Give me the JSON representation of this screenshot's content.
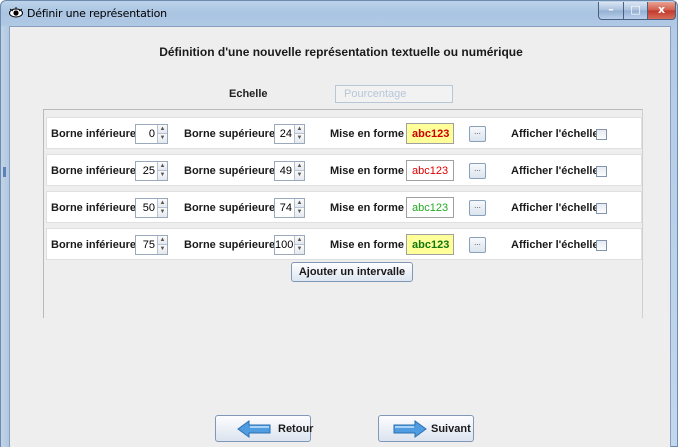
{
  "window": {
    "title": "Définir une représentation",
    "controls": {
      "minimize": "–",
      "maximize": "□",
      "close": "x"
    }
  },
  "main": {
    "title": "Définition d'une nouvelle représentation textuelle ou numérique",
    "echelle_label": "Echelle",
    "echelle_value": "Pourcentage"
  },
  "intervals": [
    {
      "lower_label": "Borne inférieure:",
      "lower": "0",
      "upper_label": "Borne supérieure:",
      "upper": "24",
      "format_label": "Mise en forme :",
      "format_text": "abc123",
      "format_text_color": "#cc0000",
      "format_bg": "#ffff99",
      "format_bold": true,
      "format_btn": "...",
      "show_scale_label": "Afficher l'échelle:",
      "show_scale": false
    },
    {
      "lower_label": "Borne inférieure:",
      "lower": "25",
      "upper_label": "Borne supérieure:",
      "upper": "49",
      "format_label": "Mise en forme :",
      "format_text": "abc123",
      "format_text_color": "#dd0000",
      "format_bg": "#ffffff",
      "format_bold": false,
      "format_btn": "...",
      "show_scale_label": "Afficher l'échelle:",
      "show_scale": false
    },
    {
      "lower_label": "Borne inférieure:",
      "lower": "50",
      "upper_label": "Borne supérieure:",
      "upper": "74",
      "format_label": "Mise en forme :",
      "format_text": "abc123",
      "format_text_color": "#22aa22",
      "format_bg": "#ffffff",
      "format_bold": false,
      "format_btn": "...",
      "show_scale_label": "Afficher l'échelle:",
      "show_scale": false
    },
    {
      "lower_label": "Borne inférieure:",
      "lower": "75",
      "upper_label": "Borne supérieure:",
      "upper": "100",
      "format_label": "Mise en forme :",
      "format_text": "abc123",
      "format_text_color": "#117711",
      "format_bg": "#ffff99",
      "format_bold": true,
      "format_btn": "...",
      "show_scale_label": "Afficher l'échelle:",
      "show_scale": false
    }
  ],
  "actions": {
    "add_interval": "Ajouter un intervalle",
    "back": "Retour",
    "next": "Suivant"
  },
  "icons": {
    "title": "eye-icon",
    "back": "arrow-left-icon",
    "next": "arrow-right-icon"
  },
  "colors": {
    "arrow_fill": "#4f9de0",
    "arrow_stroke": "#2a6fb3"
  }
}
